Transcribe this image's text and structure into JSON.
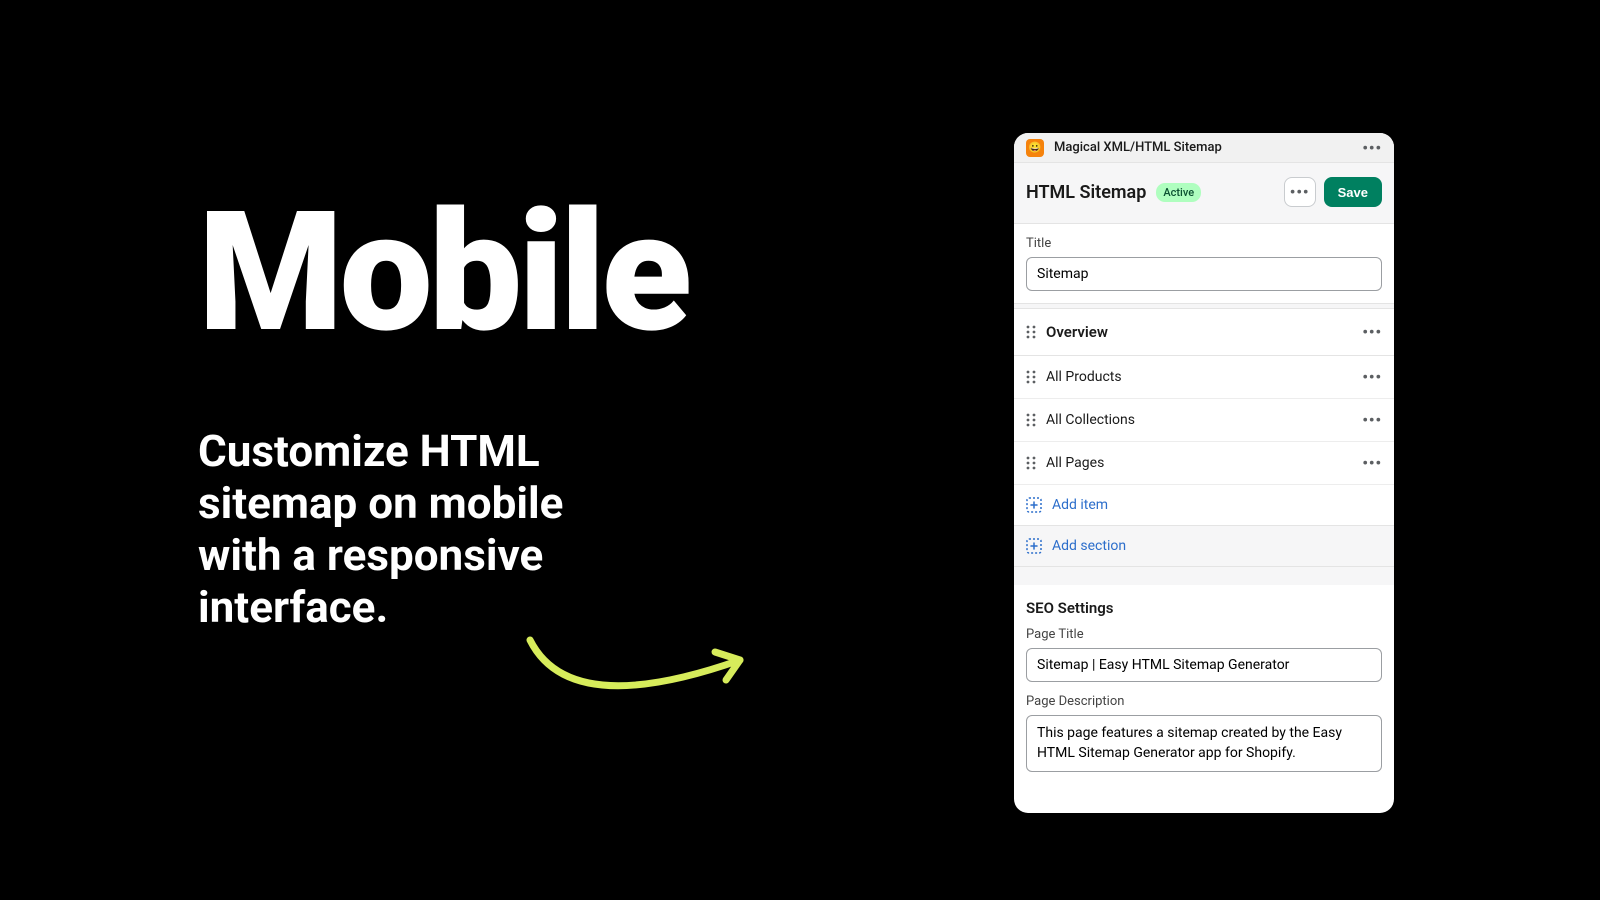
{
  "hero": {
    "title": "Mobile",
    "subtitle": "Customize HTML sitemap on mobile with a responsive interface."
  },
  "app": {
    "name": "Magical XML/HTML Sitemap",
    "icon_emoji": "😀"
  },
  "header": {
    "title": "HTML Sitemap",
    "status_badge": "Active",
    "save_label": "Save"
  },
  "title_field": {
    "label": "Title",
    "value": "Sitemap"
  },
  "blocks": {
    "overview_label": "Overview",
    "items": [
      {
        "label": "All Products"
      },
      {
        "label": "All Collections"
      },
      {
        "label": "All Pages"
      }
    ],
    "add_item_label": "Add item",
    "add_section_label": "Add section"
  },
  "seo": {
    "heading": "SEO Settings",
    "page_title_label": "Page Title",
    "page_title_value": "Sitemap | Easy HTML Sitemap Generator",
    "page_description_label": "Page Description",
    "page_description_value": "This page features a sitemap created by the Easy HTML Sitemap Generator app for Shopify."
  }
}
